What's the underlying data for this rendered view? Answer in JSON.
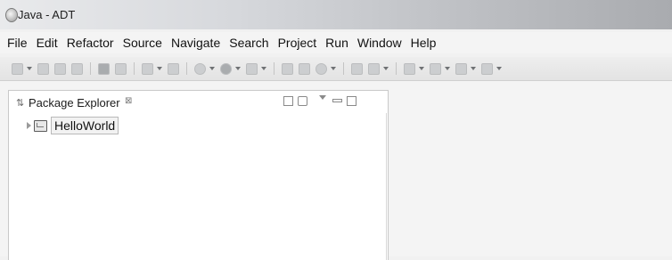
{
  "window": {
    "title": "Java - ADT"
  },
  "menu": [
    "File",
    "Edit",
    "Refactor",
    "Source",
    "Navigate",
    "Search",
    "Project",
    "Run",
    "Window",
    "Help"
  ],
  "package_explorer": {
    "tab_label": "Package Explorer",
    "close_glyph": "⊠",
    "projects": [
      {
        "label": "HelloWorld"
      }
    ]
  }
}
